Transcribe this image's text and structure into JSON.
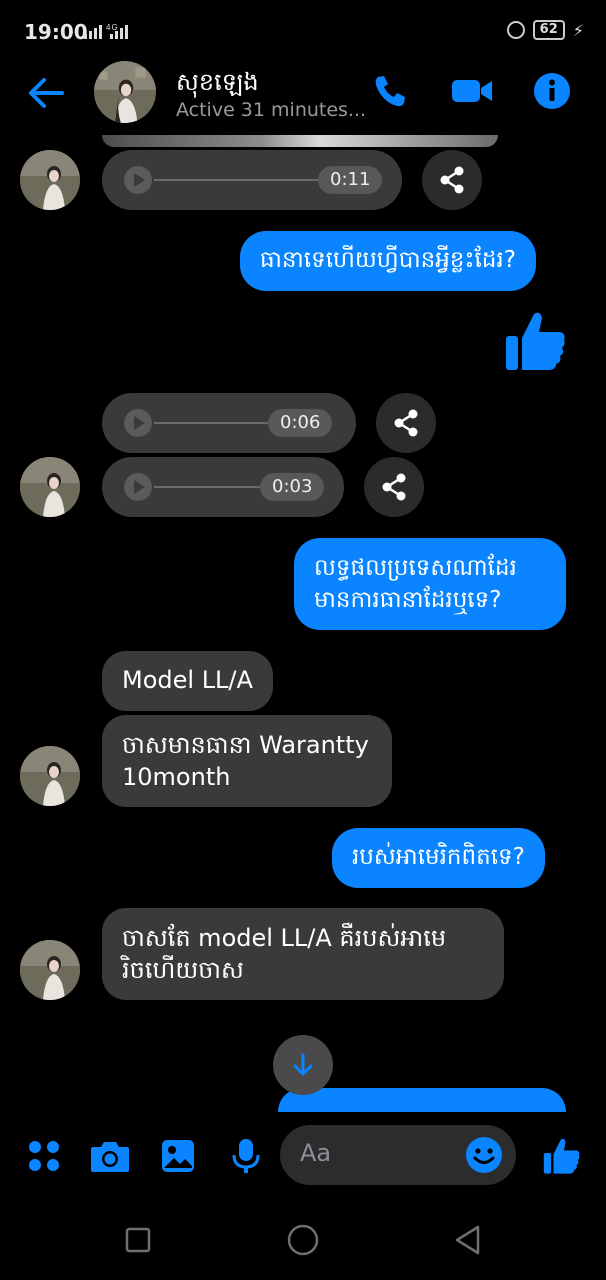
{
  "status_bar": {
    "time": "19:00",
    "signal": "4G",
    "battery": "62"
  },
  "header": {
    "contact_name": "សុខឡេង",
    "active_status": "Active 31 minutes...",
    "accent": "#0a84ff"
  },
  "messages": {
    "voice_1_duration": "0:11",
    "out_1": "ធានាទេហើយហ្វីបានអ្វីខ្លះដែរ?",
    "voice_2_duration": "0:06",
    "voice_3_duration": "0:03",
    "out_2_line1": "លទ្ធផលប្រទេសណាដែរ",
    "out_2_line2": "មានការធានាដែរឬទេ?",
    "in_1": "Model LL/A",
    "in_2_line1": "ចាសមានធានា Warantty",
    "in_2_line2": "10month",
    "out_3": "របស់អាមេរិកពិតទេ?",
    "in_3_line1": "ចាសតែ model LL/A គឺរបស់អាមេ",
    "in_3_line2": "រិចហើយចាស"
  },
  "composer": {
    "placeholder": "Aa"
  }
}
